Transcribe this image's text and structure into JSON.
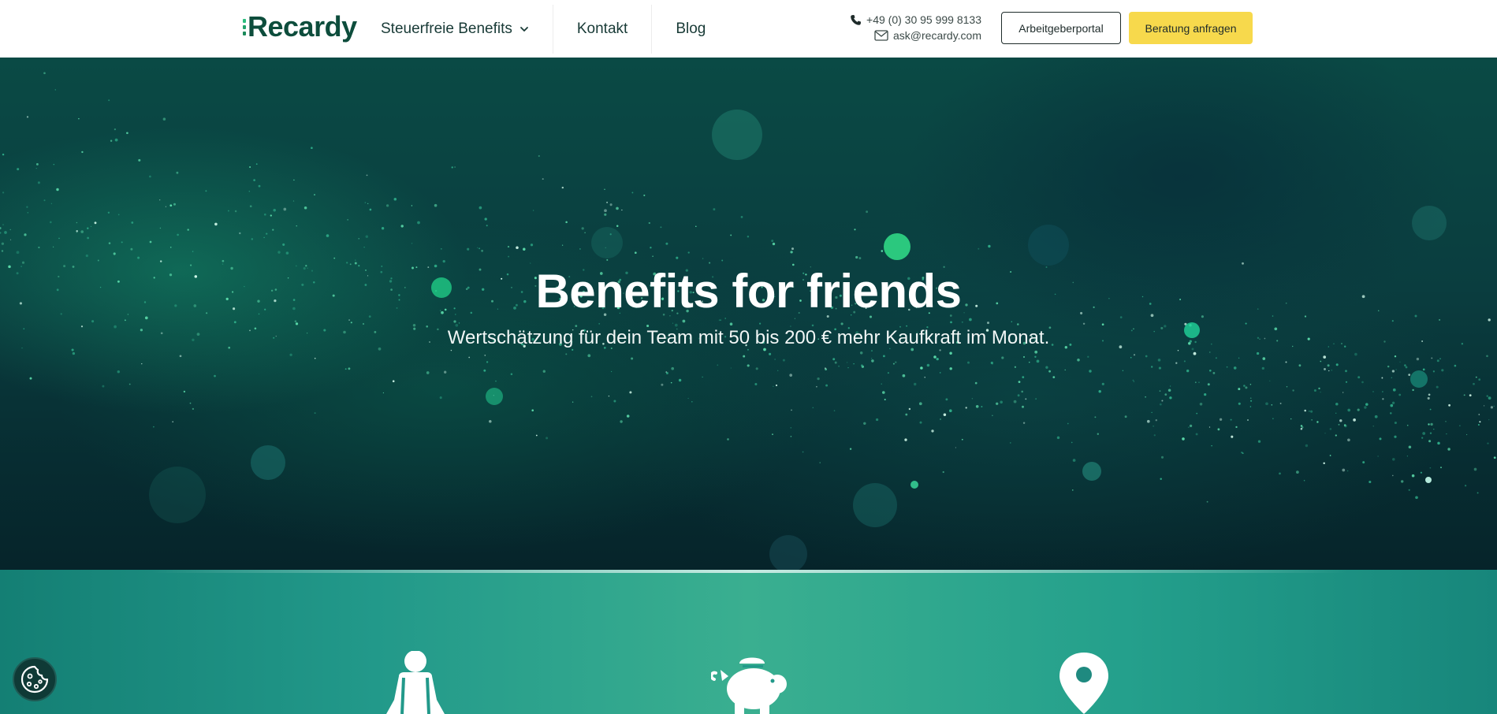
{
  "header": {
    "logo_text": "Recardy",
    "nav": {
      "benefits_label": "Steuerfreie Benefits",
      "contact_label": "Kontakt",
      "blog_label": "Blog"
    },
    "phone": "+49 (0) 30 95 999 8133",
    "email": "ask@recardy.com",
    "employer_portal_label": "Arbeitgeberportal",
    "consultation_label": "Beratung anfragen"
  },
  "hero": {
    "title": "Benefits for friends",
    "subtitle": "Wertschätzung für dein Team mit 50 bis 200 € mehr Kaufkraft im Monat."
  },
  "features": {
    "icons": [
      "person-icon",
      "piggy-bank-icon",
      "map-pin-icon"
    ]
  },
  "cookie": {
    "icon": "cookie-icon"
  },
  "colors": {
    "brand_dark": "#0d4d3c",
    "brand_green": "#2dbd7e",
    "cta_yellow": "#f7d94c",
    "teal": "#22998a"
  }
}
